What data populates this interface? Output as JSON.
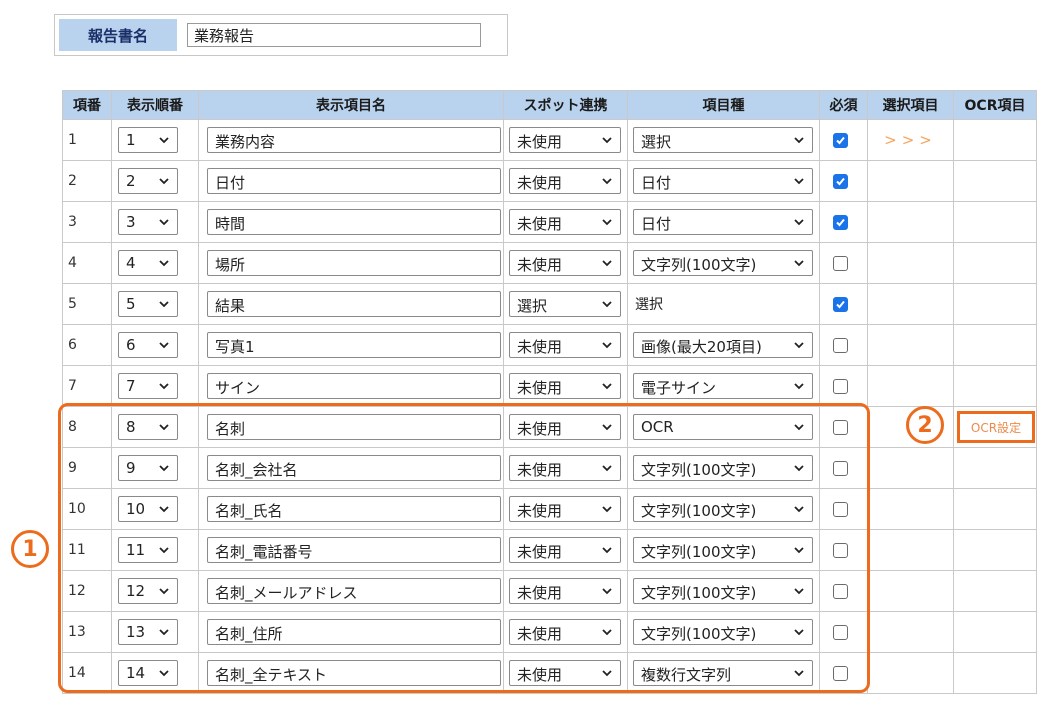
{
  "report": {
    "label": "報告書名",
    "value": "業務報告"
  },
  "headers": [
    "項番",
    "表示順番",
    "表示項目名",
    "スポット連携",
    "項目種",
    "必須",
    "選択項目",
    "OCR項目"
  ],
  "rows": [
    {
      "no": "1",
      "order": "1",
      "name": "業務内容",
      "spot": "未使用",
      "type": "選択",
      "type_plain": false,
      "required": true,
      "select_link": ">>>",
      "ocr": ""
    },
    {
      "no": "2",
      "order": "2",
      "name": "日付",
      "spot": "未使用",
      "type": "日付",
      "type_plain": false,
      "required": true,
      "select_link": "",
      "ocr": ""
    },
    {
      "no": "3",
      "order": "3",
      "name": "時間",
      "spot": "未使用",
      "type": "日付",
      "type_plain": false,
      "required": true,
      "select_link": "",
      "ocr": ""
    },
    {
      "no": "4",
      "order": "4",
      "name": "場所",
      "spot": "未使用",
      "type": "文字列(100文字)",
      "type_plain": false,
      "required": false,
      "select_link": "",
      "ocr": ""
    },
    {
      "no": "5",
      "order": "5",
      "name": "結果",
      "spot": "選択",
      "type": "選択",
      "type_plain": true,
      "required": true,
      "select_link": "",
      "ocr": ""
    },
    {
      "no": "6",
      "order": "6",
      "name": "写真1",
      "spot": "未使用",
      "type": "画像(最大20項目)",
      "type_plain": false,
      "required": false,
      "select_link": "",
      "ocr": ""
    },
    {
      "no": "7",
      "order": "7",
      "name": "サイン",
      "spot": "未使用",
      "type": "電子サイン",
      "type_plain": false,
      "required": false,
      "select_link": "",
      "ocr": ""
    },
    {
      "no": "8",
      "order": "8",
      "name": "名刺",
      "spot": "未使用",
      "type": "OCR",
      "type_plain": false,
      "required": false,
      "select_link": "",
      "ocr": "OCR設定"
    },
    {
      "no": "9",
      "order": "9",
      "name": "名刺_会社名",
      "spot": "未使用",
      "type": "文字列(100文字)",
      "type_plain": false,
      "required": false,
      "select_link": "",
      "ocr": ""
    },
    {
      "no": "10",
      "order": "10",
      "name": "名刺_氏名",
      "spot": "未使用",
      "type": "文字列(100文字)",
      "type_plain": false,
      "required": false,
      "select_link": "",
      "ocr": ""
    },
    {
      "no": "11",
      "order": "11",
      "name": "名刺_電話番号",
      "spot": "未使用",
      "type": "文字列(100文字)",
      "type_plain": false,
      "required": false,
      "select_link": "",
      "ocr": ""
    },
    {
      "no": "12",
      "order": "12",
      "name": "名刺_メールアドレス",
      "spot": "未使用",
      "type": "文字列(100文字)",
      "type_plain": false,
      "required": false,
      "select_link": "",
      "ocr": ""
    },
    {
      "no": "13",
      "order": "13",
      "name": "名刺_住所",
      "spot": "未使用",
      "type": "文字列(100文字)",
      "type_plain": false,
      "required": false,
      "select_link": "",
      "ocr": ""
    },
    {
      "no": "14",
      "order": "14",
      "name": "名刺_全テキスト",
      "spot": "未使用",
      "type": "複数行文字列",
      "type_plain": false,
      "required": false,
      "select_link": "",
      "ocr": ""
    }
  ],
  "annotations": {
    "marker1": "1",
    "marker2": "2"
  },
  "colors": {
    "header_bg": "#b9d3ee",
    "accent": "#ec6b1c",
    "checkbox": "#1a73e8",
    "link": "#f5a35c"
  },
  "icons": {
    "dropdown": "chevron-down-icon",
    "checked": "check-icon"
  }
}
